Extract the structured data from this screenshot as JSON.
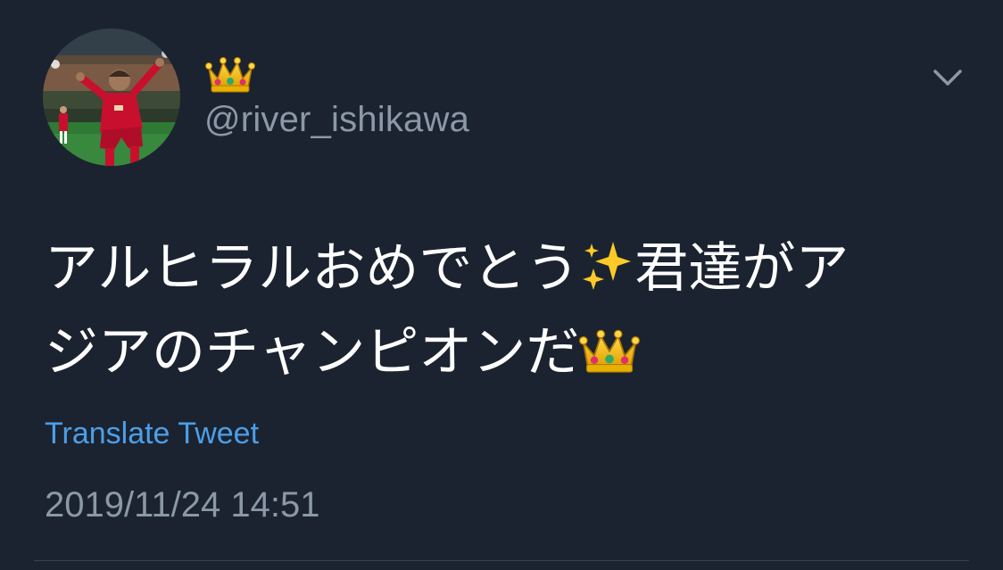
{
  "user": {
    "display_name_icon": "crown-icon",
    "handle": "@river_ishikawa"
  },
  "tweet": {
    "text_line1_a": "アルヒラルおめでとう",
    "text_line1_emoji": "sparkles-icon",
    "text_line1_b": "君達がア",
    "text_line2": "ジアのチャンピオンだ",
    "text_line2_emoji": "crown-icon"
  },
  "actions": {
    "translate_label": "Translate Tweet",
    "menu_icon": "chevron-down-icon"
  },
  "meta": {
    "timestamp": "2019/11/24 14:51"
  },
  "colors": {
    "background": "#1b2330",
    "text": "#ffffff",
    "secondary_text": "#8b98a5",
    "link": "#4c9fe8",
    "divider": "#38444d"
  }
}
